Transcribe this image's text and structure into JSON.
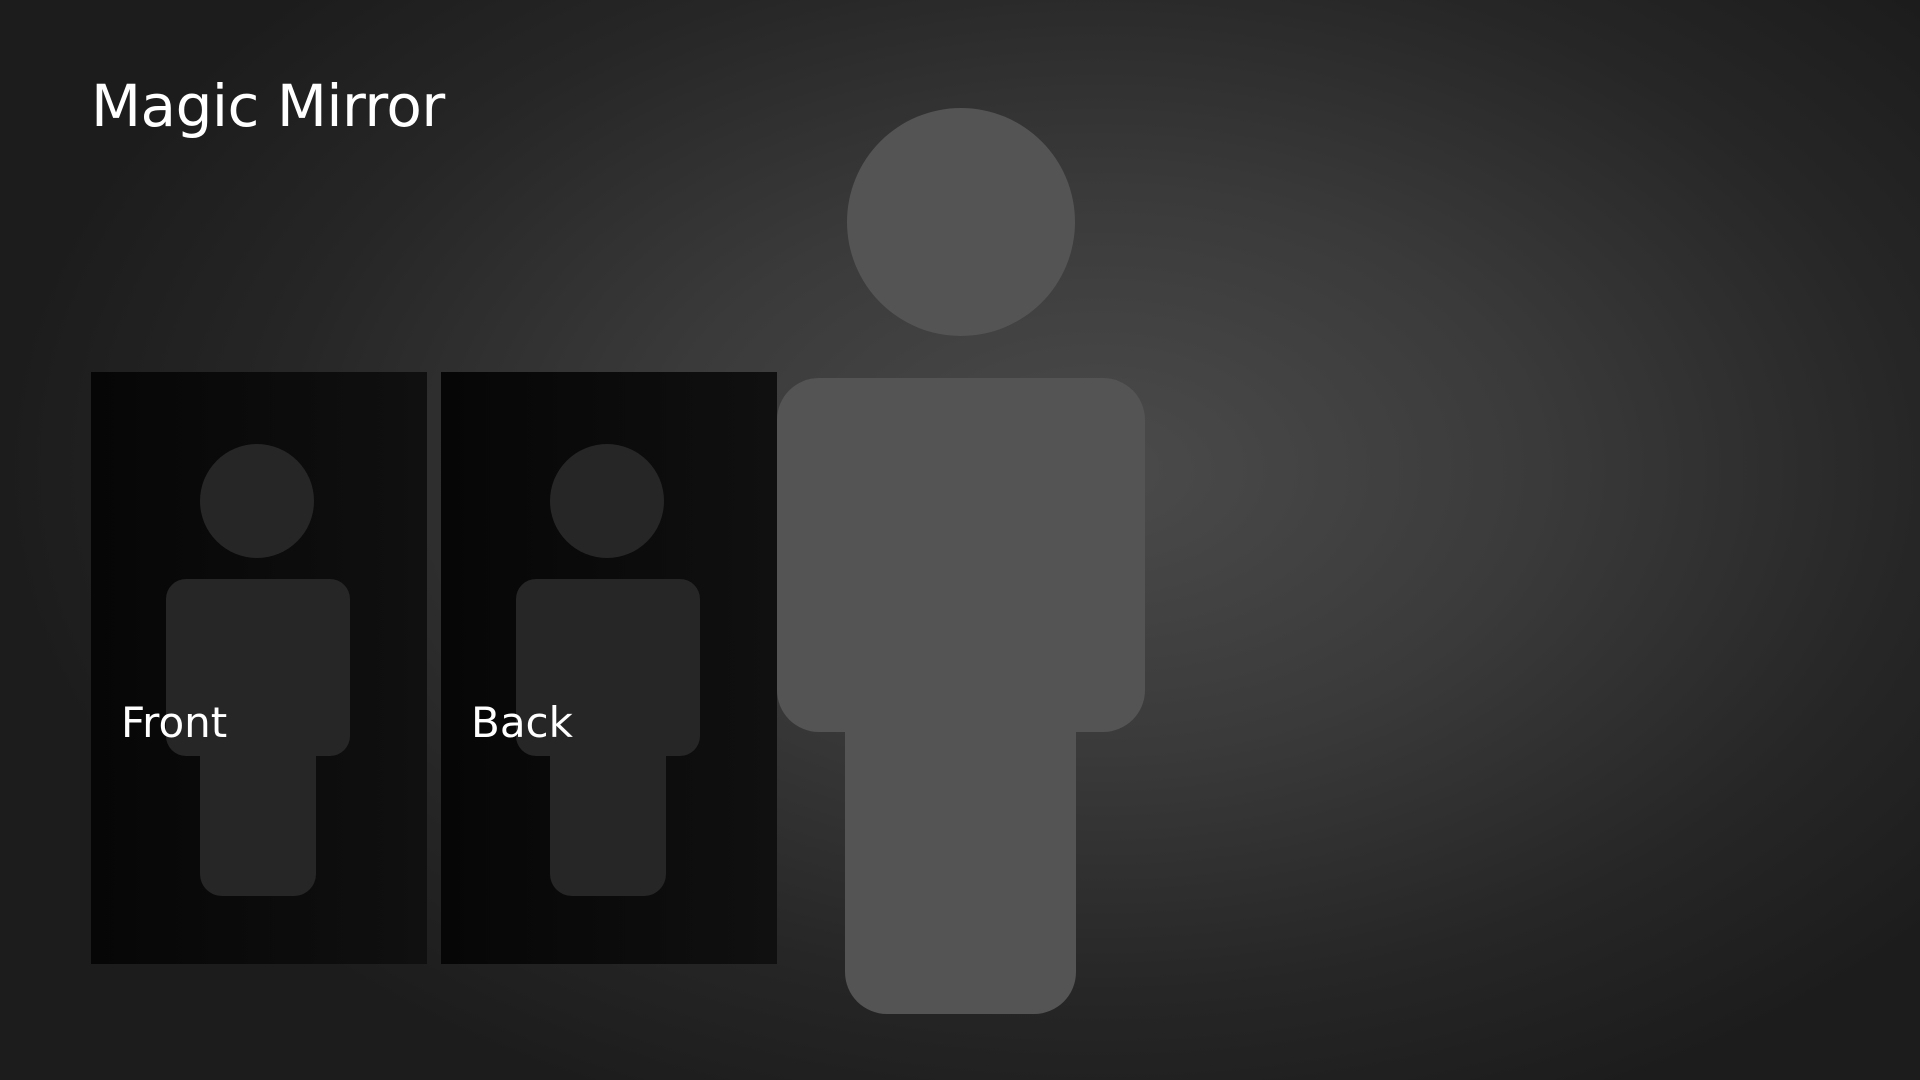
{
  "app": {
    "title": "Magic Mirror"
  },
  "tiles": [
    {
      "label": "Front",
      "icon": "person-icon"
    },
    {
      "label": "Back",
      "icon": "person-icon"
    }
  ],
  "hero": {
    "icon": "person-icon"
  },
  "colors": {
    "background_center": "#4b4b4b",
    "background_edge": "#1c1c1c",
    "hero_figure": "#545454",
    "tile_background": "#0b0b0b",
    "tile_figure": "#262626",
    "text": "#ffffff"
  }
}
